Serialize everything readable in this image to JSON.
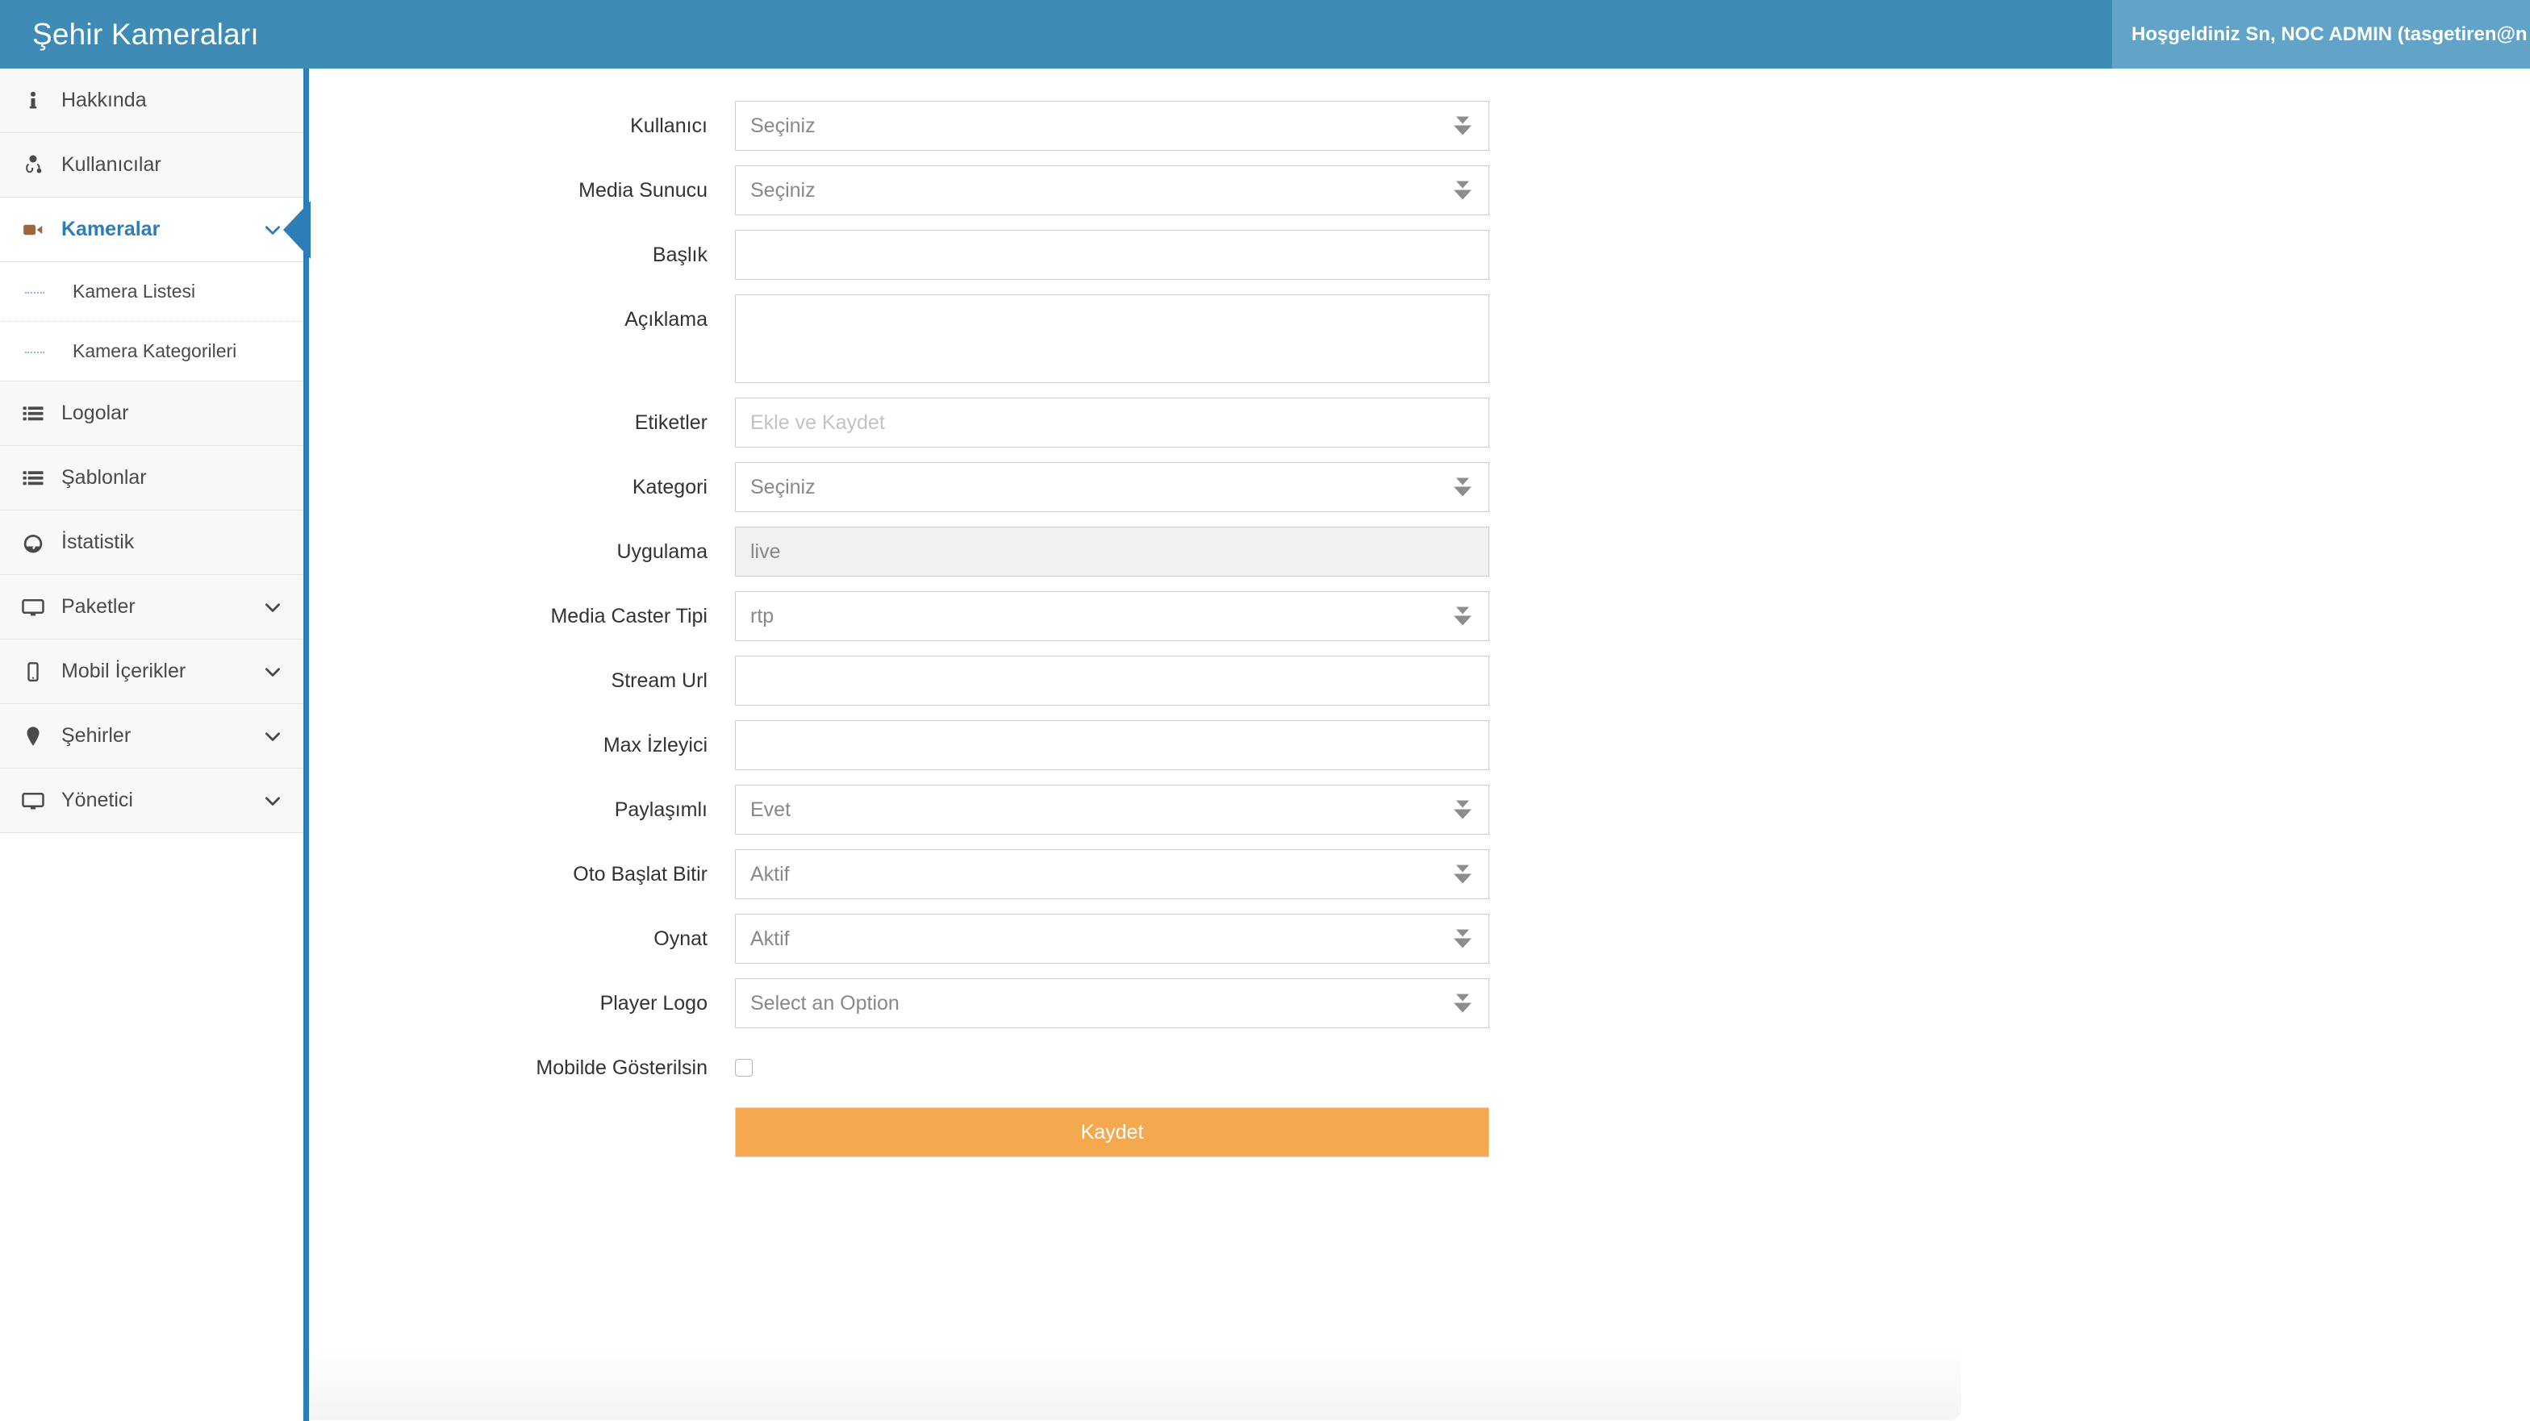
{
  "header": {
    "brand": "Şehir Kameraları",
    "user_greeting": "Hoşgeldiniz Sn, NOC ADMIN (tasgetiren@n",
    "brand_color": "#3e8bb5",
    "user_panel_color": "#62a3c8"
  },
  "sidebar": {
    "accent_color": "#2e7cb8",
    "items": [
      {
        "label": "Hakkında",
        "icon": "info-icon",
        "caret": false,
        "active": false
      },
      {
        "label": "Kullanıcılar",
        "icon": "user-md-icon",
        "caret": false,
        "active": false
      },
      {
        "label": "Kameralar",
        "icon": "video-camera-icon",
        "caret": true,
        "active": true
      },
      {
        "label": "Logolar",
        "icon": "list-icon",
        "caret": false,
        "active": false
      },
      {
        "label": "Şablonlar",
        "icon": "list-icon",
        "caret": false,
        "active": false
      },
      {
        "label": "İstatistik",
        "icon": "dashboard-icon",
        "caret": false,
        "active": false
      },
      {
        "label": "Paketler",
        "icon": "desktop-icon",
        "caret": true,
        "active": false
      },
      {
        "label": "Mobil İçerikler",
        "icon": "mobile-icon",
        "caret": true,
        "active": false
      },
      {
        "label": "Şehirler",
        "icon": "map-pin-icon",
        "caret": true,
        "active": false
      },
      {
        "label": "Yönetici",
        "icon": "desktop-icon",
        "caret": true,
        "active": false
      }
    ],
    "submenu": [
      {
        "label": "Kamera Listesi"
      },
      {
        "label": "Kamera Kategorileri"
      }
    ]
  },
  "form": {
    "fields": [
      {
        "label": "Kullanıcı",
        "type": "select",
        "value": "Seçiniz"
      },
      {
        "label": "Media Sunucu",
        "type": "select",
        "value": "Seçiniz"
      },
      {
        "label": "Başlık",
        "type": "text",
        "value": ""
      },
      {
        "label": "Açıklama",
        "type": "textarea",
        "value": ""
      },
      {
        "label": "Etiketler",
        "type": "text",
        "value": "",
        "placeholder": "Ekle ve Kaydet"
      },
      {
        "label": "Kategori",
        "type": "select",
        "value": "Seçiniz"
      },
      {
        "label": "Uygulama",
        "type": "readonly",
        "value": "live"
      },
      {
        "label": "Media Caster Tipi",
        "type": "select",
        "value": "rtp"
      },
      {
        "label": "Stream Url",
        "type": "text",
        "value": ""
      },
      {
        "label": "Max İzleyici",
        "type": "text",
        "value": ""
      },
      {
        "label": "Paylaşımlı",
        "type": "select",
        "value": "Evet"
      },
      {
        "label": "Oto Başlat Bitir",
        "type": "select",
        "value": "Aktif"
      },
      {
        "label": "Oynat",
        "type": "select",
        "value": "Aktif"
      },
      {
        "label": "Player Logo",
        "type": "select",
        "value": "Select an Option"
      },
      {
        "label": "Mobilde Gösterilsin",
        "type": "checkbox",
        "checked": false
      }
    ],
    "submit_label": "Kaydet",
    "submit_color": "#f5a94f"
  }
}
